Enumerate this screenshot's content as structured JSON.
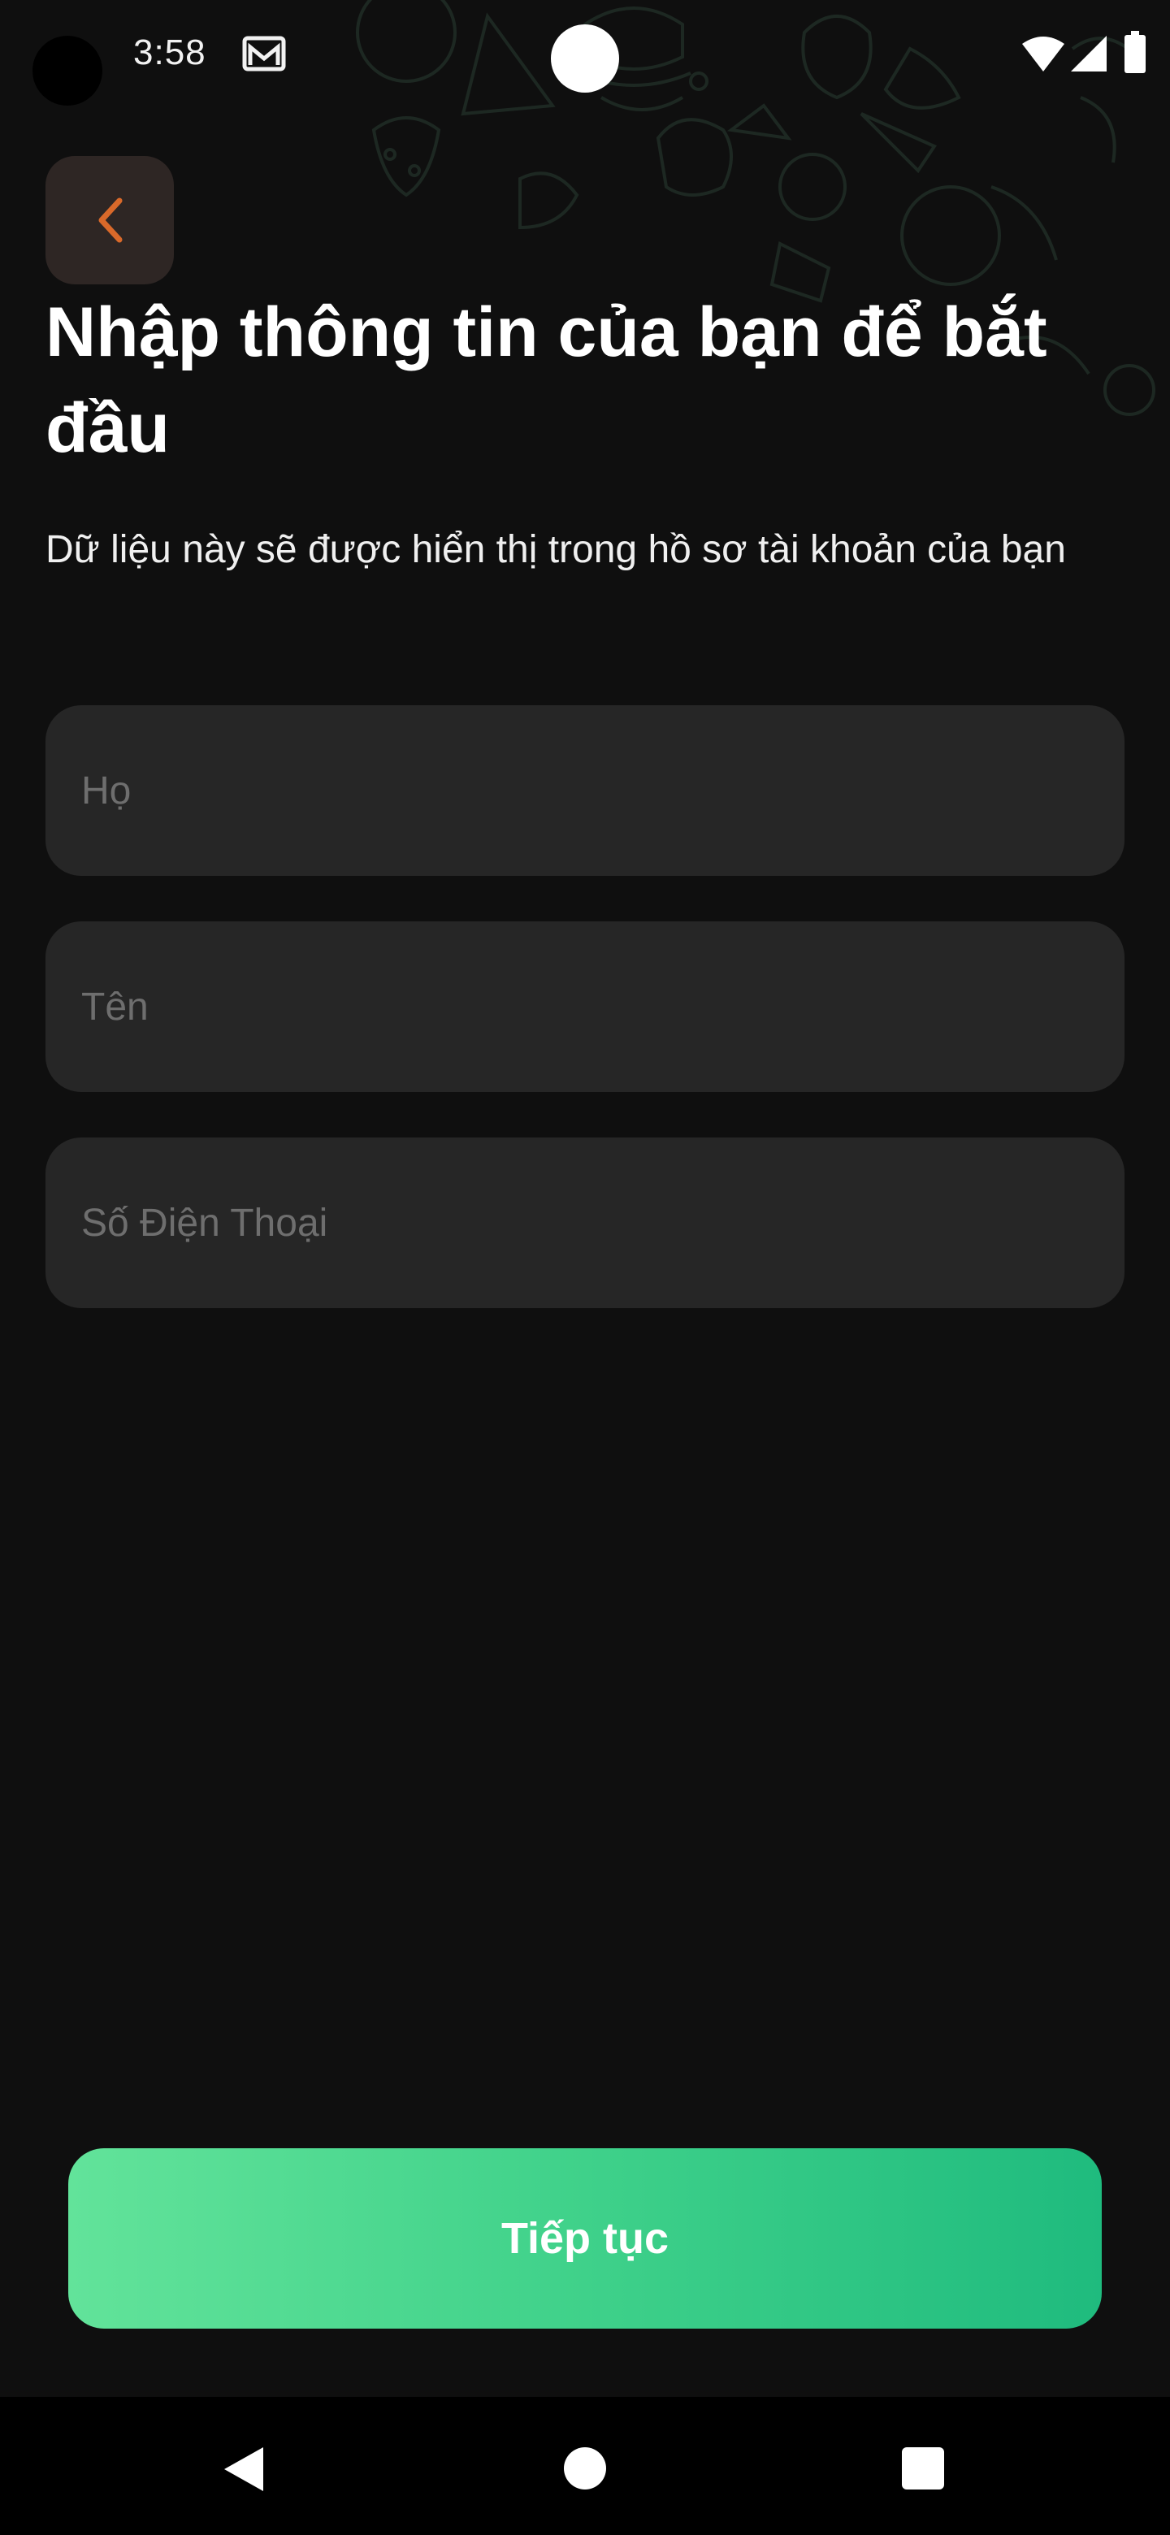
{
  "status_bar": {
    "time": "3:58",
    "icons": [
      "camera-hole",
      "gmail-icon",
      "wifi-icon",
      "signal-icon",
      "battery-icon"
    ]
  },
  "header": {
    "back_icon": "chevron-left-icon",
    "title": "Nhập thông tin của bạn để bắt đầu",
    "subtitle": "Dữ liệu này sẽ được hiển thị trong hồ sơ tài khoản của bạn"
  },
  "form": {
    "fields": [
      {
        "placeholder": "Họ",
        "value": ""
      },
      {
        "placeholder": "Tên",
        "value": ""
      },
      {
        "placeholder": "Số Điện Thoại",
        "value": ""
      }
    ]
  },
  "actions": {
    "continue_label": "Tiếp tục"
  },
  "nav_bar": {
    "icons": [
      "back-triangle-icon",
      "home-circle-icon",
      "recents-square-icon"
    ]
  },
  "colors": {
    "background": "#0f0f0f",
    "field_background": "#262626",
    "back_button_background": "#2e2624",
    "accent_orange": "#d9692a",
    "button_gradient_start": "#62e39a",
    "button_gradient_end": "#1fbb7e"
  }
}
